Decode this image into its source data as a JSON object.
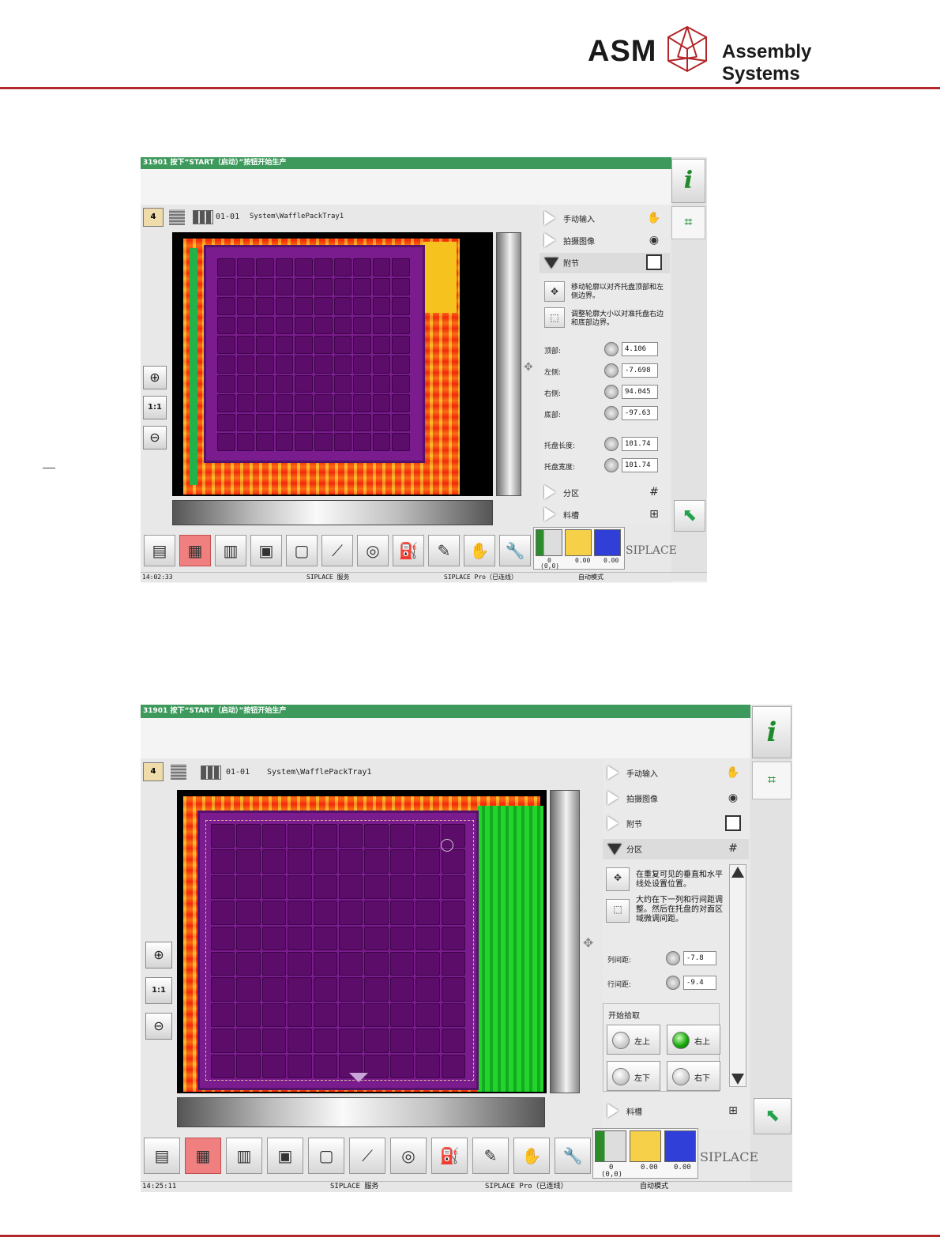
{
  "header": {
    "brand": "ASM",
    "brand_tagline": "Assembly Systems",
    "accent_color": "#b3262a"
  },
  "screens": [
    {
      "title_bar": "31901 按下“START（启动）”按钮开始生产",
      "badge": "4",
      "position": "01-01",
      "path": "System\\WafflePackTray1",
      "menu": {
        "manual": "手动输入",
        "photo": "拍摄图像",
        "adjust": "附节",
        "partition": "分区",
        "magazine": "料槽"
      },
      "hints": [
        "移动轮廓以对齐托盘顶部和左侧边界。",
        "调整轮廓大小以对准托盘右边和底部边界。"
      ],
      "params": [
        {
          "label": "顶部:",
          "value": "4.106"
        },
        {
          "label": "左侧:",
          "value": "-7.698"
        },
        {
          "label": "右侧:",
          "value": "94.045"
        },
        {
          "label": "底部:",
          "value": "-97.63"
        },
        {
          "label": "托盘长度:",
          "value": "101.74"
        },
        {
          "label": "托盘宽度:",
          "value": "101.74"
        }
      ],
      "status_values": {
        "left": "0",
        "coord": "(0,0)",
        "mid": "0.00",
        "right": "0.00"
      },
      "siplace": "SIPLACE",
      "status_bar": {
        "time": "14:02:33",
        "service": "SIPLACE 服务",
        "pro": "SIPLACE Pro（已连线）",
        "mode": "自动模式"
      },
      "zoom_ratio": "1:1"
    },
    {
      "title_bar": "31901 按下“START（启动）”按钮开始生产",
      "badge": "4",
      "position": "01-01",
      "path": "System\\WafflePackTray1",
      "menu": {
        "manual": "手动输入",
        "photo": "拍摄图像",
        "adjust": "附节",
        "partition": "分区",
        "magazine": "料槽"
      },
      "hints": [
        "在重复可见的垂直和水平线处设置位置。",
        "大约在下一列和行间距调整。然后在托盘的对面区域微调间距。"
      ],
      "params": [
        {
          "label": "列间距:",
          "value": "-7.8"
        },
        {
          "label": "行间距:",
          "value": "-9.4"
        }
      ],
      "pick_title": "开始拾取",
      "pick_options": [
        "左上",
        "右上",
        "左下",
        "右下"
      ],
      "pick_selected": "右上",
      "status_values": {
        "left": "0",
        "coord": "(0,0)",
        "mid": "0.00",
        "right": "0.00"
      },
      "siplace": "SIPLACE",
      "status_bar": {
        "time": "14:25:11",
        "service": "SIPLACE 服务",
        "pro": "SIPLACE Pro（已连线）",
        "mode": "自动模式"
      },
      "zoom_ratio": "1:1"
    }
  ]
}
